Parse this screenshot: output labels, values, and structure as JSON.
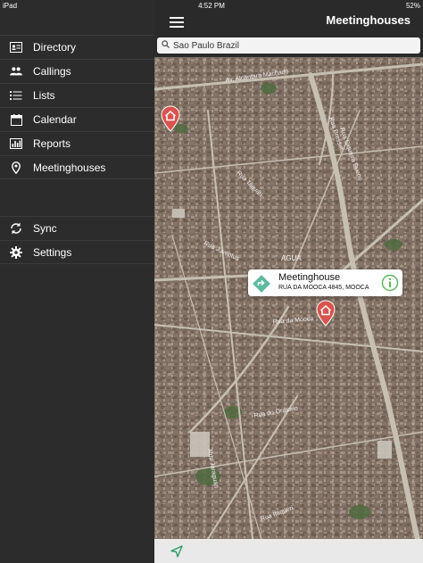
{
  "status_bar": {
    "device": "iPad",
    "time": "4:52 PM",
    "battery": "52%"
  },
  "sidebar": {
    "items": [
      {
        "label": "Directory",
        "icon": "contact-card-icon"
      },
      {
        "label": "Callings",
        "icon": "people-icon"
      },
      {
        "label": "Lists",
        "icon": "list-icon"
      },
      {
        "label": "Calendar",
        "icon": "calendar-icon"
      },
      {
        "label": "Reports",
        "icon": "bar-chart-icon"
      },
      {
        "label": "Meetinghouses",
        "icon": "location-pin-icon"
      }
    ],
    "secondary": [
      {
        "label": "Sync",
        "icon": "sync-icon"
      },
      {
        "label": "Settings",
        "icon": "gear-icon"
      }
    ]
  },
  "header": {
    "title": "Meetinghouses"
  },
  "search": {
    "value": "Sao Paulo Brazil"
  },
  "map": {
    "street_labels": [
      "Av. Alcantara Machado",
      "Rua Bresser",
      "Rua Siqueira Bueno",
      "Rua do Oratorio",
      "Rua da Mooca",
      "Rua Taquari",
      "Rua Juventus",
      "Rua Itaqueri",
      "Rua Jaraguari",
      "AGUA"
    ],
    "callout": {
      "title": "Meetinghouse",
      "address": "RUA DA MOOCA 4845, MOOCA"
    }
  },
  "colors": {
    "sidebar_bg": "#2c2c2c",
    "pin": "#d9534f",
    "callout_icon": "#5fb9a0"
  }
}
